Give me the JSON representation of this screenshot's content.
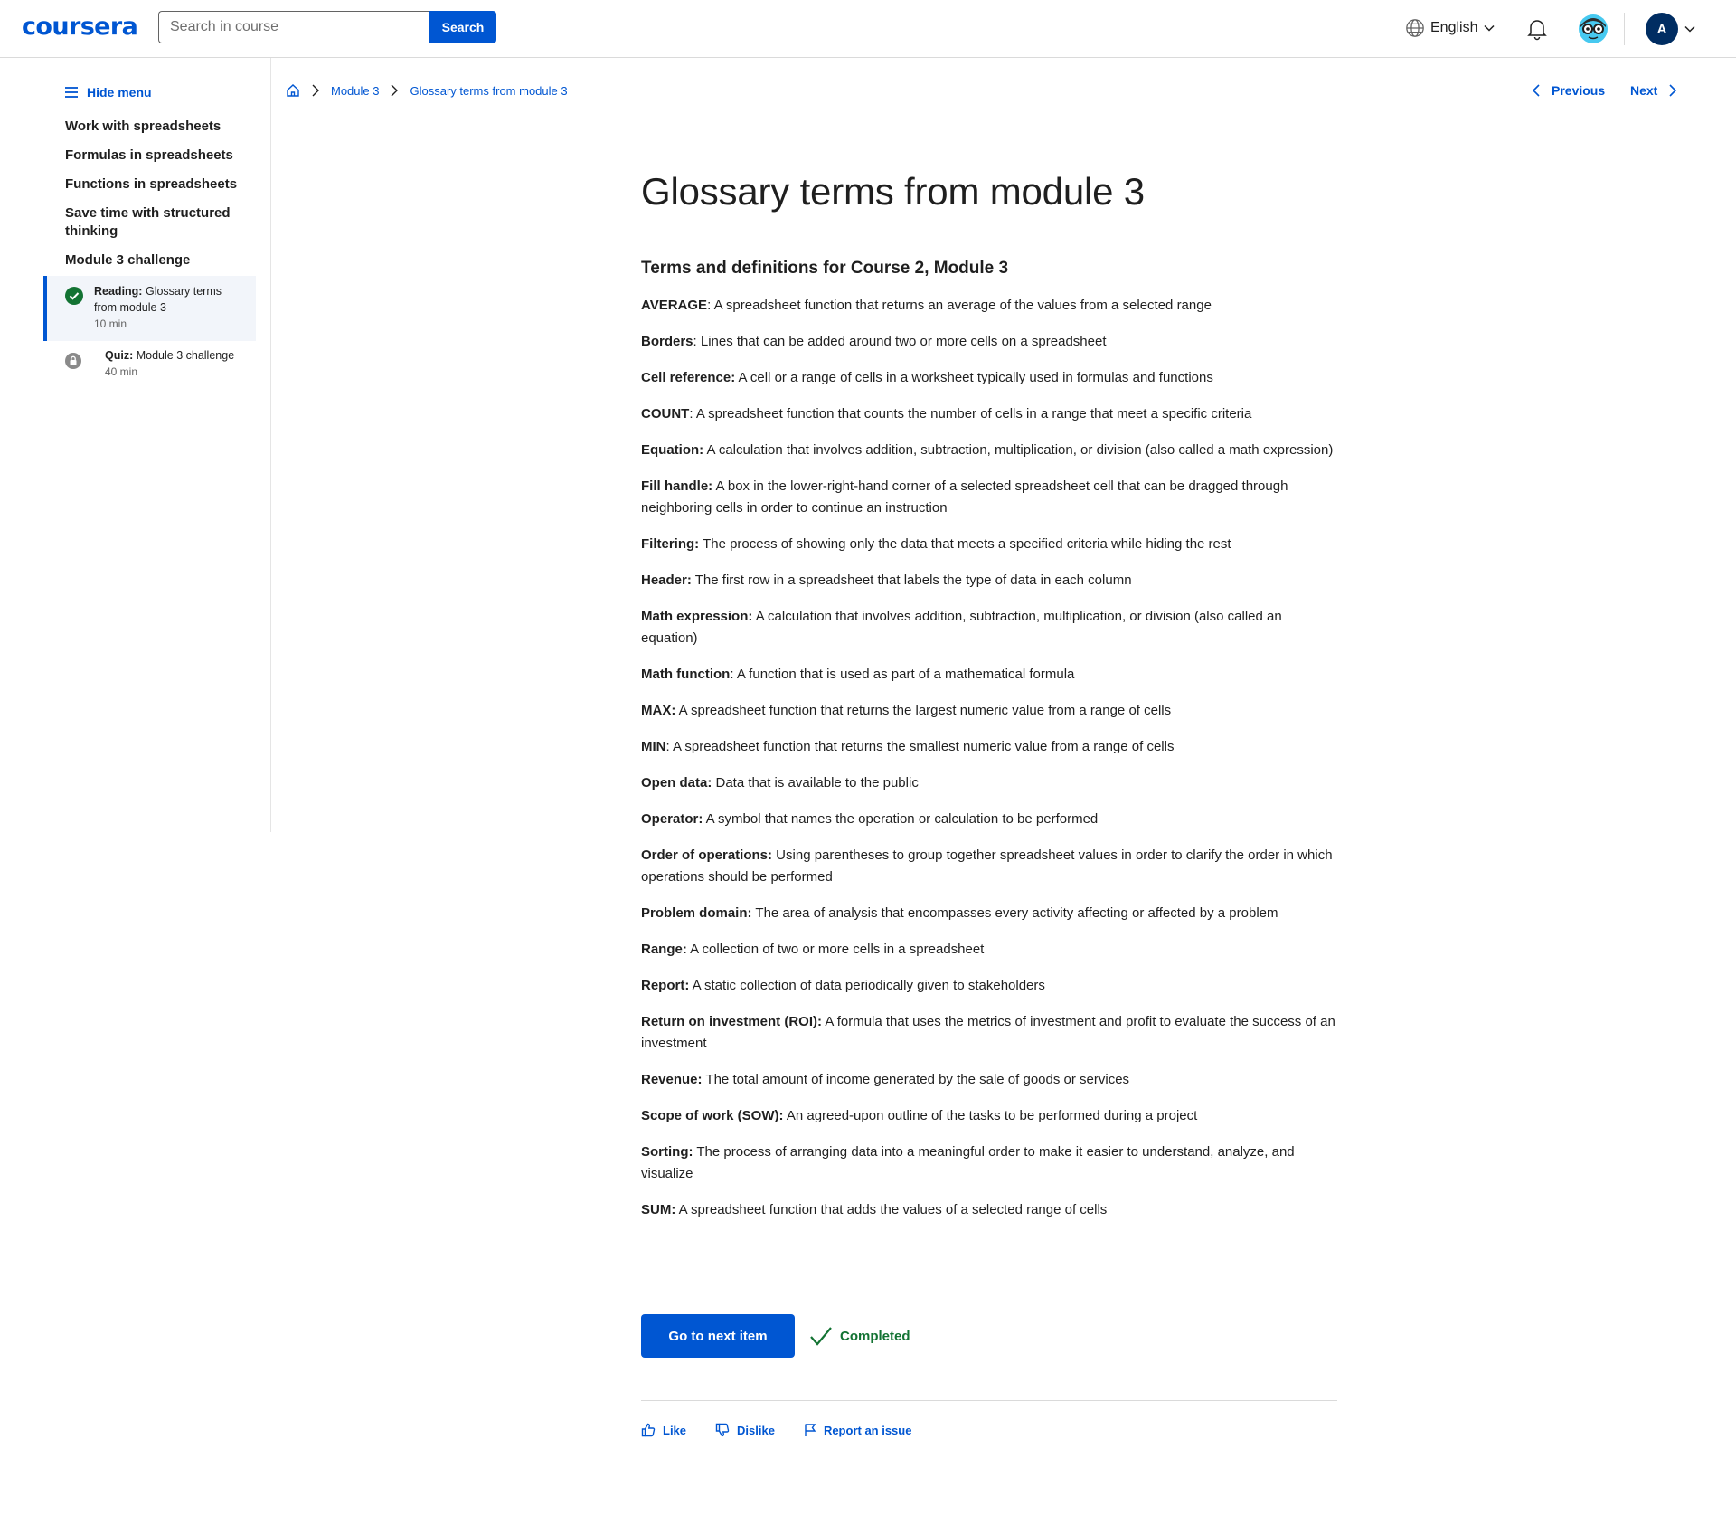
{
  "header": {
    "logo": "coursera",
    "search": {
      "placeholder": "Search in course",
      "button": "Search"
    },
    "language": "English",
    "avatar_initial": "A",
    "icons": [
      "globe-icon",
      "chevron-down-icon",
      "bell-icon",
      "coach-icon"
    ]
  },
  "sidebar": {
    "hide_menu": "Hide menu",
    "items": [
      {
        "label": "Work with spreadsheets"
      },
      {
        "label": "Formulas in spreadsheets"
      },
      {
        "label": "Functions in spreadsheets"
      },
      {
        "label": "Save time with structured thinking"
      },
      {
        "label": "Module 3 challenge"
      }
    ],
    "subitems": [
      {
        "type": "Reading:",
        "title": "Glossary terms from module 3",
        "duration": "10 min",
        "status": "completed"
      },
      {
        "type": "Quiz:",
        "title": "Module 3 challenge",
        "duration": "40 min",
        "status": "locked"
      }
    ]
  },
  "breadcrumb": {
    "module": "Module 3",
    "current": "Glossary terms from module 3"
  },
  "nav": {
    "previous": "Previous",
    "next": "Next"
  },
  "main": {
    "title": "Glossary terms from module 3",
    "subheading": "Terms and definitions for Course 2, Module 3",
    "terms": [
      {
        "term": "AVERAGE",
        "definition": ": A spreadsheet function that returns an average of the values from a selected range"
      },
      {
        "term": "Borders",
        "definition": ": Lines that can be added around two or more cells on a spreadsheet"
      },
      {
        "term": "Cell reference:",
        "definition": " A cell or a range of cells in a worksheet typically used in formulas and functions"
      },
      {
        "term": "COUNT",
        "definition": ": A spreadsheet function that counts the number of cells in a range that meet a specific criteria"
      },
      {
        "term": "Equation:",
        "definition": " A calculation that involves addition, subtraction, multiplication, or division (also called a math expression)"
      },
      {
        "term": "Fill handle:",
        "definition": " A box in the lower-right-hand corner of a selected spreadsheet cell that can be dragged through neighboring cells in order to continue an instruction"
      },
      {
        "term": "Filtering:",
        "definition": " The process of showing only the data that meets a specified criteria while hiding the rest"
      },
      {
        "term": "Header:",
        "definition": " The first row in a spreadsheet that labels the type of data in each column"
      },
      {
        "term": "Math expression:",
        "definition": " A calculation that involves addition, subtraction, multiplication, or division (also called an equation)"
      },
      {
        "term": "Math function",
        "definition": ": A function that is used as part of a mathematical formula"
      },
      {
        "term": "MAX:",
        "definition": " A spreadsheet function that returns the largest numeric value from a range of cells"
      },
      {
        "term": "MIN",
        "definition": ": A spreadsheet function that returns the smallest numeric value from a range of cells"
      },
      {
        "term": "Open data:",
        "definition": " Data that is available to the public"
      },
      {
        "term": "Operator:",
        "definition": " A symbol that names the operation or calculation to be performed"
      },
      {
        "term": "Order of operations:",
        "definition": " Using parentheses to group together spreadsheet values in order to clarify the order in which operations should be performed"
      },
      {
        "term": "Problem domain:",
        "definition": " The area of analysis that encompasses every activity affecting or affected by a problem"
      },
      {
        "term": "Range:",
        "definition": " A collection of two or more cells in a spreadsheet"
      },
      {
        "term": "Report:",
        "definition": " A static collection of data periodically given to stakeholders"
      },
      {
        "term": "Return on investment (ROI):",
        "definition": " A formula that uses the metrics of investment and profit to evaluate the success of an investment"
      },
      {
        "term": "Revenue:",
        "definition": " The total amount of income generated by the sale of goods or services"
      },
      {
        "term": "Scope of work (SOW):",
        "definition": " An agreed-upon outline of the tasks to be performed during a project"
      },
      {
        "term": "Sorting:",
        "definition": " The process of arranging data into a meaningful order to make it easier to understand, analyze, and visualize"
      },
      {
        "term": "SUM:",
        "definition": " A spreadsheet function that adds the values of a selected range of cells"
      }
    ],
    "next_button": "Go to next item",
    "completed_label": "Completed"
  },
  "feedback": {
    "like": "Like",
    "dislike": "Dislike",
    "report": "Report an issue"
  },
  "colors": {
    "brand": "#0056d2",
    "success": "#137333",
    "text": "#1f1f1f",
    "avatar": "#002d62"
  }
}
